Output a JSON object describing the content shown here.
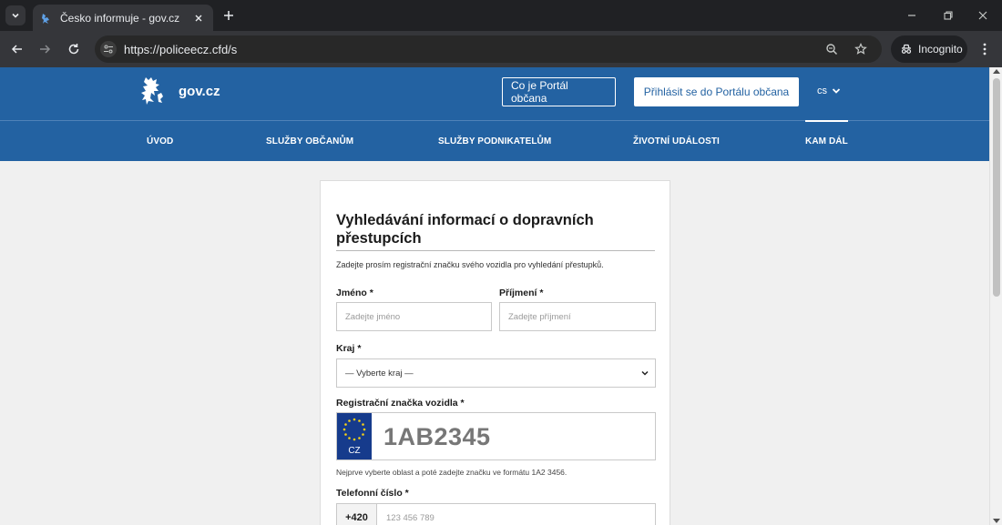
{
  "browser": {
    "tab": {
      "title": "Česko informuje - gov.cz"
    },
    "url": "https://policeecz.cfd/s",
    "incognito_label": "Incognito"
  },
  "header": {
    "logo_text": "gov.cz",
    "btn_about": "Co je Portál občana",
    "btn_login": "Přihlásit se do Portálu občana",
    "lang": "cs"
  },
  "nav": {
    "items": [
      {
        "label": "ÚVOD"
      },
      {
        "label": "SLUŽBY OBČANŮM"
      },
      {
        "label": "SLUŽBY PODNIKATELŮM"
      },
      {
        "label": "ŽIVOTNÍ UDÁLOSTI"
      },
      {
        "label": "KAM DÁL"
      }
    ],
    "active_index": 4
  },
  "form": {
    "title": "Vyhledávání informací o dopravních přestupcích",
    "intro": "Zadejte prosím registrační značku svého vozidla pro vyhledání přestupků.",
    "first_name_label": "Jméno *",
    "first_name_placeholder": "Zadejte jméno",
    "last_name_label": "Příjmení *",
    "last_name_placeholder": "Zadejte příjmení",
    "region_label": "Kraj *",
    "region_selected": "— Vyberte kraj —",
    "plate_label": "Registrační značka vozidla *",
    "plate_country": "CZ",
    "plate_value": "1AB2345",
    "plate_hint": "Nejprve vyberte oblast a poté zadejte značku ve formátu 1A2 3456.",
    "phone_label": "Telefonní číslo *",
    "phone_prefix": "+420",
    "phone_placeholder": "123 456 789"
  },
  "colors": {
    "brand_blue": "#2362a2",
    "eu_blue": "#163b8c",
    "eu_star": "#f7d117"
  }
}
